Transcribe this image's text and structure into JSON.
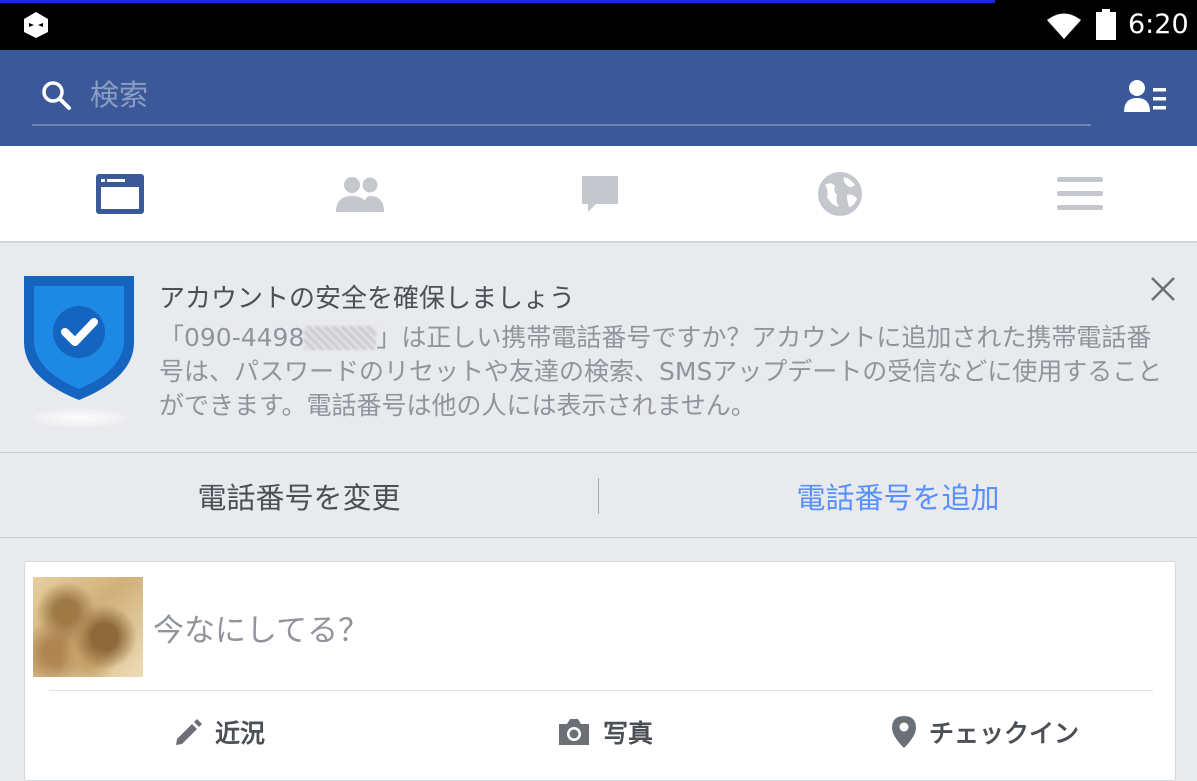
{
  "status_bar": {
    "time": "6:20",
    "icons": [
      "app-icon",
      "wifi-icon",
      "battery-icon"
    ]
  },
  "search": {
    "placeholder": "検索",
    "value": ""
  },
  "tabs": [
    {
      "icon": "news-feed-icon",
      "active": true
    },
    {
      "icon": "friends-icon",
      "active": false
    },
    {
      "icon": "messages-icon",
      "active": false
    },
    {
      "icon": "notifications-globe-icon",
      "active": false
    },
    {
      "icon": "menu-icon",
      "active": false
    }
  ],
  "security_banner": {
    "title": "アカウントの安全を確保しましょう",
    "body_prefix": "「090-4498",
    "body_suffix": "」は正しい携帯電話番号ですか？アカウントに追加された携帯電話番号は、パスワードのリセットや友達の検索、SMSアップデートの受信などに使用することができます。電話番号は他の人には表示されません。",
    "change_button": "電話番号を変更",
    "add_button": "電話番号を追加"
  },
  "composer": {
    "prompt": "今なにしてる？",
    "actions": {
      "status": "近況",
      "photo": "写真",
      "checkin": "チェックイン"
    }
  },
  "colors": {
    "brand_blue": "#3b5998",
    "link_blue": "#5890ff",
    "active_tab": "#3b5998",
    "inactive_tab": "#c4c7cc",
    "background": "#e9eaed"
  }
}
